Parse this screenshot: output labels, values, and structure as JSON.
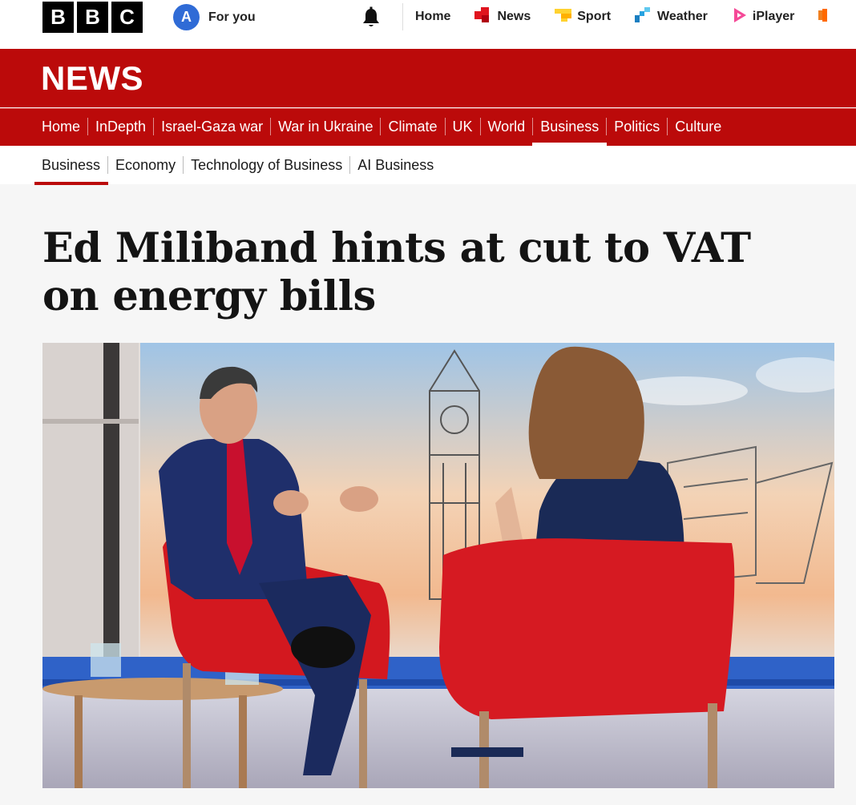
{
  "masthead": {
    "logo_letters": [
      "B",
      "B",
      "C"
    ],
    "avatar_letter": "A",
    "for_you_label": "For you"
  },
  "top_nav": [
    {
      "label": "Home",
      "icon": "none"
    },
    {
      "label": "News",
      "icon": "news-icon",
      "color": "#e0141e"
    },
    {
      "label": "Sport",
      "icon": "sport-icon",
      "color": "#ffd230"
    },
    {
      "label": "Weather",
      "icon": "weather-icon",
      "color": "#1a7fc1"
    },
    {
      "label": "iPlayer",
      "icon": "iplayer-icon",
      "color": "#f54997"
    }
  ],
  "banner": {
    "title": "NEWS",
    "color": "#bb0a0a"
  },
  "section_nav": [
    {
      "label": "Home",
      "active": false
    },
    {
      "label": "InDepth",
      "active": false
    },
    {
      "label": "Israel-Gaza war",
      "active": false
    },
    {
      "label": "War in Ukraine",
      "active": false
    },
    {
      "label": "Climate",
      "active": false
    },
    {
      "label": "UK",
      "active": false
    },
    {
      "label": "World",
      "active": false
    },
    {
      "label": "Business",
      "active": true
    },
    {
      "label": "Politics",
      "active": false
    },
    {
      "label": "Culture",
      "active": false
    }
  ],
  "sub_nav": [
    {
      "label": "Business",
      "active": true
    },
    {
      "label": "Economy",
      "active": false
    },
    {
      "label": "Technology of Business",
      "active": false
    },
    {
      "label": "AI Business",
      "active": false
    }
  ],
  "article": {
    "headline": "Ed Miliband hints at cut to VAT on energy bills"
  }
}
